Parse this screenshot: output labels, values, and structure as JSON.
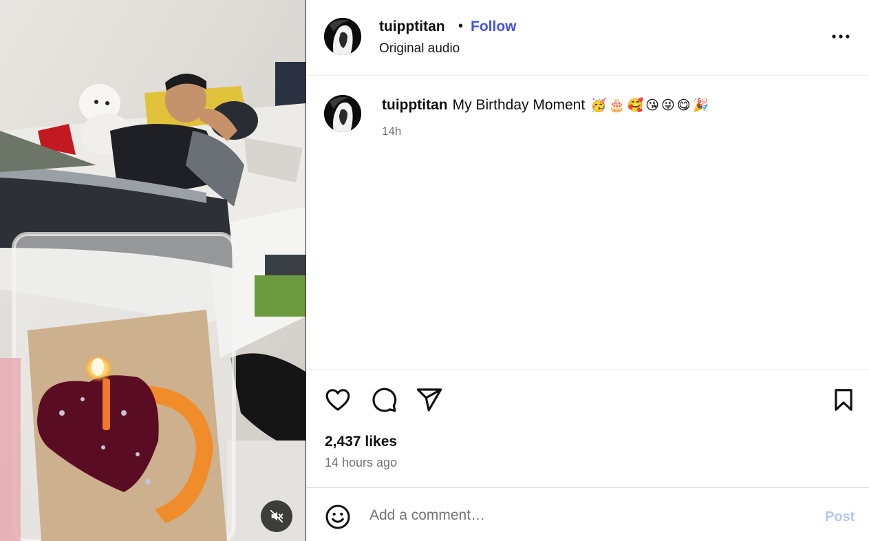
{
  "post": {
    "username": "tuipptitan",
    "dot": "•",
    "follow_label": "Follow",
    "audio_label": "Original audio",
    "caption_text": "My Birthday Moment",
    "caption_emojis": "🥳🎂🥰😘😜😋🎉",
    "time_short": "14h",
    "likes": "2,437 likes",
    "time_long": "14 hours ago"
  },
  "comment": {
    "placeholder": "Add a comment…",
    "post_label": "Post"
  },
  "icons": {
    "more": "more-options-icon",
    "like": "heart-icon",
    "comment": "comment-icon",
    "share": "share-icon",
    "save": "bookmark-icon",
    "emoji": "emoji-icon",
    "mute": "muted-speaker-icon"
  },
  "colors": {
    "follow": "#4150f7",
    "post_disabled": "#b3c8f7",
    "secondary_text": "#737373"
  }
}
